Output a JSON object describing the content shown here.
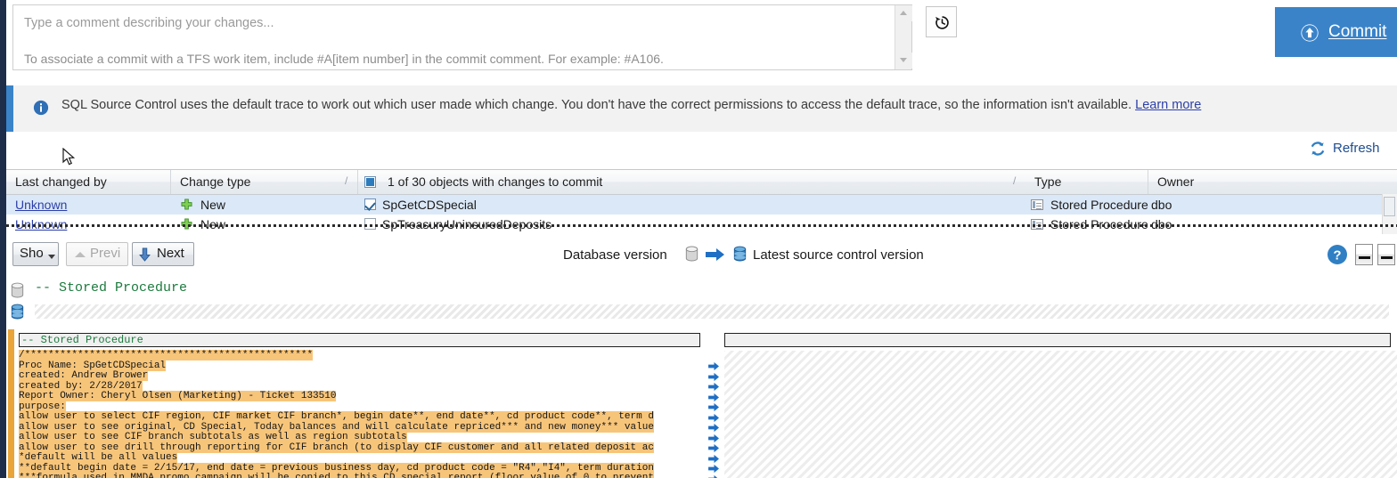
{
  "comment": {
    "placeholder": "Type a comment describing your changes...",
    "hint": "To associate a commit with a TFS work item, include #A[item number] in the commit comment. For example: #A106.",
    "history_icon": "history-clock-icon"
  },
  "commit_button": {
    "label": "Commit",
    "icon": "upload-arrow-up-circle-icon",
    "color": "#3a83c9"
  },
  "info_bar": {
    "icon": "info-circle-icon",
    "text": "SQL Source Control uses the default trace to work out which user made which change. You don't have the correct permissions to access the default trace, so the information isn't available.",
    "link": "Learn more",
    "accent_color": "#3a83c9"
  },
  "refresh": {
    "label": "Refresh",
    "icon": "refresh-circular-arrows-icon"
  },
  "grid": {
    "columns": [
      "Last changed by",
      "Change type",
      "1 of 30 objects with changes to commit",
      "Type",
      "Owner"
    ],
    "select_all_state": "partial",
    "rows": [
      {
        "last_changed_by": "Unknown",
        "change_type": "New",
        "change_icon": "plus-green-icon",
        "object": "SpGetCDSpecial",
        "checked": true,
        "type": "Stored Procedure",
        "type_icon": "stored-procedure-icon",
        "owner": "dbo"
      },
      {
        "last_changed_by": "Unknown",
        "change_type": "New",
        "change_icon": "plus-green-icon",
        "object": "SpTreasuryUninsuredDeposits",
        "checked": false,
        "type": "Stored Procedure",
        "type_icon": "stored-procedure-icon",
        "owner": "dbo"
      }
    ]
  },
  "toolbar": {
    "show_label": "Sho",
    "previous_label": "Previ",
    "next_label": "Next",
    "database_version_label": "Database version",
    "latest_source_label": "Latest source control version",
    "db_icon": "database-cylinder-gray-icon",
    "src_icon": "database-cylinder-blue-icon",
    "arrow_icon": "arrow-right-blue-icon",
    "help_icon": "help-question-icon"
  },
  "code_header": {
    "text": "-- Stored Procedure",
    "db_icon": "database-cylinder-gray-icon",
    "src_icon": "database-cylinder-blue-icon"
  },
  "diff": {
    "left_title": "-- Stored Procedure",
    "right_title": "",
    "left_lines": [
      {
        "text": "/*************************************************",
        "hl": "added"
      },
      {
        "text": "Proc Name: SpGetCDSpecial",
        "hl": "added"
      },
      {
        "text": "created: Andrew Brower",
        "hl": "added"
      },
      {
        "text": "created by: 2/28/2017",
        "hl": "added"
      },
      {
        "text": "Report Owner: Cheryl Olsen (Marketing) - Ticket 133510",
        "hl": "added"
      },
      {
        "text": "purpose:",
        "hl": "added"
      },
      {
        "text": "allow user to select CIF region, CIF market CIF branch*, begin date**, end date**, cd product code**, term d",
        "hl": "added"
      },
      {
        "text": "allow user to see original, CD Special, Today balances and will calculate repriced*** and new money*** value",
        "hl": "added"
      },
      {
        "text": "allow user to see CIF branch subtotals as well as region subtotals",
        "hl": "added"
      },
      {
        "text": "allow user to see drill through reporting for CIF branch (to display CIF customer and all related deposit ac",
        "hl": "added"
      },
      {
        "text": "*default will be all values",
        "hl": "added"
      },
      {
        "text": "**default begin date = 2/15/17, end date = previous business day, cd product code = \"R4\",\"I4\", term duration",
        "hl": "added"
      },
      {
        "text": "***formula used in MMDA promo campaign will be copied to this CD special report (floor value of 0 to prevent",
        "hl": "added"
      }
    ],
    "marker_icon": "arrow-right-blue-small-icon",
    "marker_count": 12,
    "change_bar_color": "#e9a43a"
  }
}
